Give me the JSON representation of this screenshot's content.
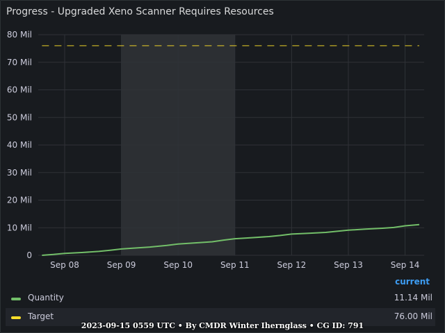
{
  "panel": {
    "title": "Progress - Upgraded Xeno Scanner Requires Resources"
  },
  "chart_data": {
    "type": "line",
    "title": "Progress - Upgraded Xeno Scanner Requires Resources",
    "y_ticks": [
      "0",
      "10 Mil",
      "20 Mil",
      "30 Mil",
      "40 Mil",
      "50 Mil",
      "60 Mil",
      "70 Mil",
      "80 Mil"
    ],
    "x_ticks": [
      "Sep 08",
      "Sep 09",
      "Sep 10",
      "Sep 11",
      "Sep 12",
      "Sep 13",
      "Sep 14"
    ],
    "ylim": [
      0,
      80
    ],
    "y_unit": "Mil",
    "xlim_days": [
      -0.4,
      6.25
    ],
    "highlight_range_days": [
      1,
      3
    ],
    "grid": true,
    "legend_placement": "bottom",
    "series": [
      {
        "name": "Quantity",
        "color": "#73bf69",
        "style": "solid",
        "x_days": [
          -0.4,
          -0.2,
          0.0,
          0.3,
          0.6,
          0.8,
          1.0,
          1.2,
          1.5,
          1.8,
          2.0,
          2.3,
          2.6,
          2.8,
          3.0,
          3.3,
          3.6,
          3.8,
          4.0,
          4.3,
          4.6,
          4.8,
          5.0,
          5.3,
          5.6,
          5.8,
          6.0,
          6.25
        ],
        "values": [
          0.0,
          0.3,
          0.7,
          1.0,
          1.4,
          1.8,
          2.3,
          2.6,
          3.0,
          3.6,
          4.1,
          4.5,
          4.9,
          5.5,
          6.0,
          6.4,
          6.8,
          7.2,
          7.7,
          8.0,
          8.3,
          8.7,
          9.1,
          9.5,
          9.8,
          10.1,
          10.7,
          11.14
        ]
      },
      {
        "name": "Target",
        "color": "#fade2a",
        "style": "dashed",
        "x_days": [
          -0.4,
          6.25
        ],
        "values": [
          76.0,
          76.0
        ]
      }
    ]
  },
  "legend": {
    "header": "current",
    "items": [
      {
        "name": "Quantity",
        "value": "11.14 Mil",
        "color": "#73bf69"
      },
      {
        "name": "Target",
        "value": "76.00 Mil",
        "color": "#fade2a"
      }
    ]
  },
  "footer": {
    "text": "2023-09-15 0559 UTC • By CMDR Winter Ihernglass • CG ID: 791"
  }
}
